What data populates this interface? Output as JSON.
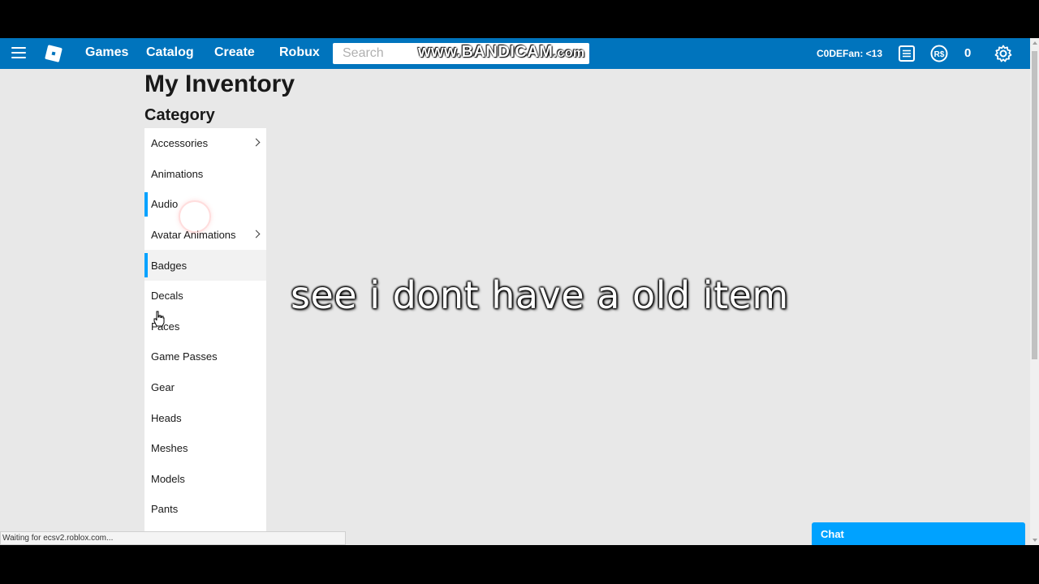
{
  "topbar": {
    "nav": [
      "Games",
      "Catalog",
      "Create",
      "Robux"
    ],
    "search_placeholder": "Search",
    "watermark": "www.BANDICAM",
    "watermark_suffix": ".com",
    "username": "C0DEFan: <13",
    "robux_amount": "0"
  },
  "page": {
    "title": "My Inventory",
    "category_title": "Category"
  },
  "categories": [
    {
      "label": "Accessories",
      "chevron": true
    },
    {
      "label": "Animations",
      "chevron": false
    },
    {
      "label": "Audio",
      "chevron": false
    },
    {
      "label": "Avatar Animations",
      "chevron": true
    },
    {
      "label": "Badges",
      "chevron": false
    },
    {
      "label": "Decals",
      "chevron": false
    },
    {
      "label": "Faces",
      "chevron": false
    },
    {
      "label": "Game Passes",
      "chevron": false
    },
    {
      "label": "Gear",
      "chevron": false
    },
    {
      "label": "Heads",
      "chevron": false
    },
    {
      "label": "Meshes",
      "chevron": false
    },
    {
      "label": "Models",
      "chevron": false
    },
    {
      "label": "Pants",
      "chevron": false
    }
  ],
  "caption": "see i dont have a old item",
  "status": "Waiting for ecsv2.roblox.com...",
  "chat": {
    "label": "Chat"
  },
  "colors": {
    "topbar": "#0074bd",
    "accent": "#00a2ff"
  }
}
